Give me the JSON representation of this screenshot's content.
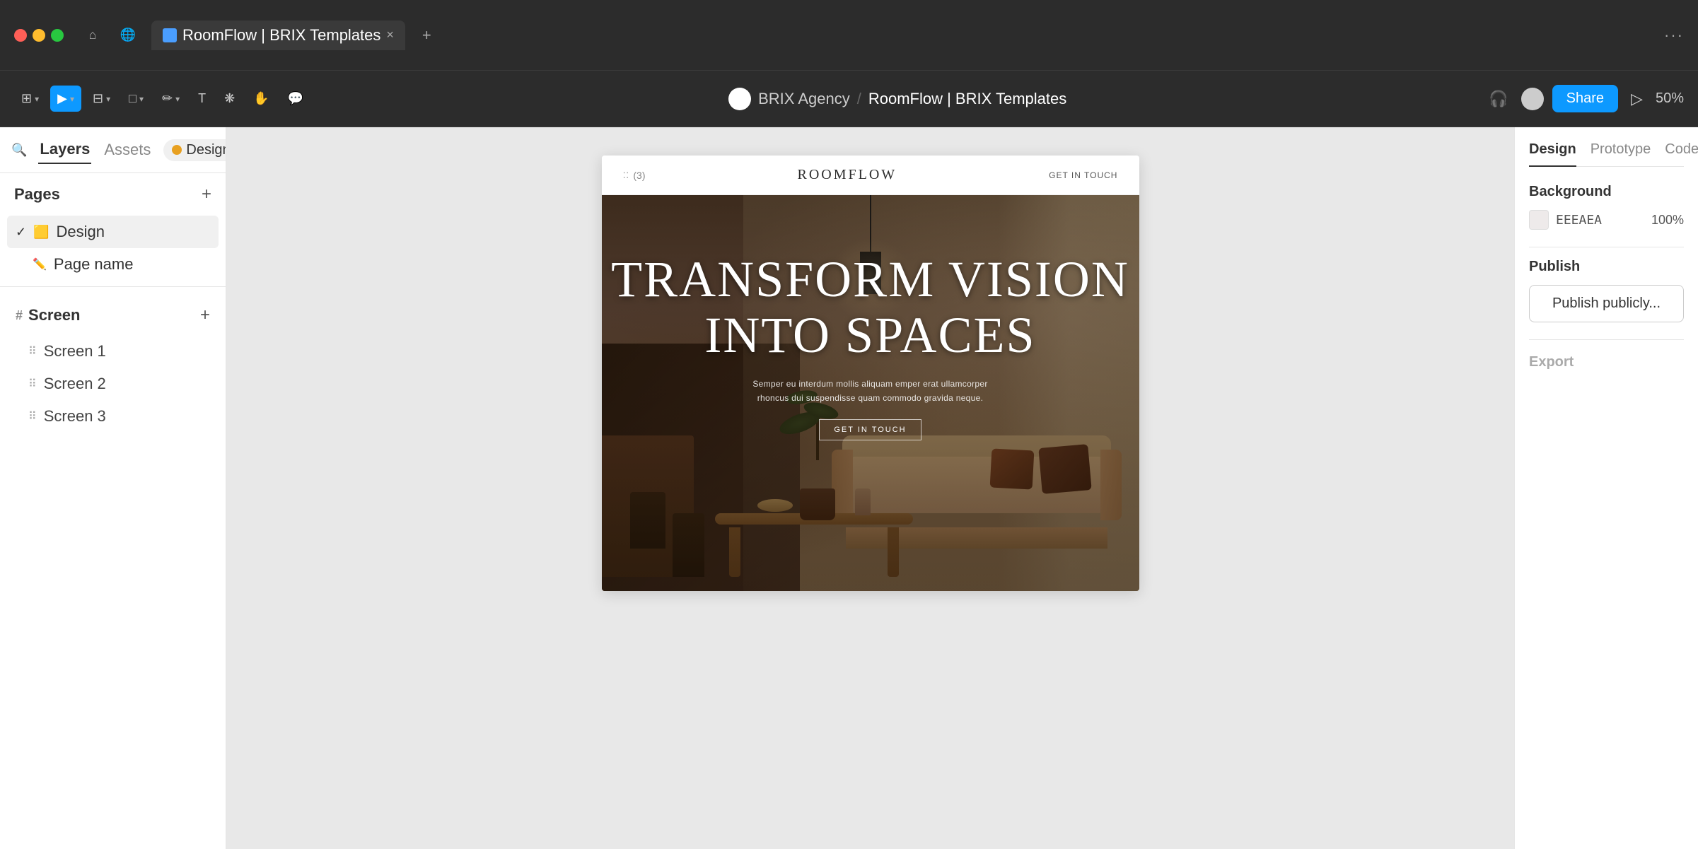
{
  "browser": {
    "dots": [
      "red",
      "yellow",
      "green"
    ],
    "tab_title": "RoomFlow | BRIX Templates",
    "tab_close": "×",
    "tab_add": "+",
    "menu": "···"
  },
  "toolbar": {
    "breadcrumb_org": "BRIX Agency",
    "breadcrumb_sep": "/",
    "breadcrumb_project": "RoomFlow | BRIX Templates",
    "share_label": "Share",
    "zoom_level": "50%"
  },
  "sidebar": {
    "search_placeholder": "Search",
    "tabs": [
      {
        "id": "layers",
        "label": "Layers",
        "active": true
      },
      {
        "id": "assets",
        "label": "Assets",
        "active": false
      }
    ],
    "design_chip": "Design",
    "pages_title": "Pages",
    "pages": [
      {
        "id": "design",
        "label": "Design",
        "emoji": "🟨",
        "active": true
      },
      {
        "id": "page-name",
        "label": "Page name",
        "pencil": true,
        "sub": true
      }
    ],
    "screen_title": "Screen",
    "screens": [
      {
        "id": "screen-1",
        "label": "Screen 1"
      },
      {
        "id": "screen-2",
        "label": "Screen 2"
      },
      {
        "id": "screen-3",
        "label": "Screen 3"
      }
    ]
  },
  "canvas": {
    "nav_dots": "::",
    "nav_count": "(3)",
    "logo": "ROOMFLOW",
    "nav_cta": "GET IN TOUCH",
    "hero_title_line1": "TRANSFORM VISION",
    "hero_title_line2": "INTO SPACES",
    "hero_subtitle": "Semper eu interdum mollis aliquam emper erat ullamcorper rhoncus dui suspendisse quam commodo gravida neque.",
    "hero_cta": "GET IN TOUCH"
  },
  "right_panel": {
    "tabs": [
      {
        "id": "design",
        "label": "Design",
        "active": true
      },
      {
        "id": "prototype",
        "label": "Prototype",
        "active": false
      },
      {
        "id": "code",
        "label": "Code",
        "active": false
      }
    ],
    "background_title": "Background",
    "background_color": "EEEAEA",
    "background_opacity": "100%",
    "publish_title": "Publish",
    "publish_btn": "Publish publicly...",
    "export_title": "Export"
  }
}
